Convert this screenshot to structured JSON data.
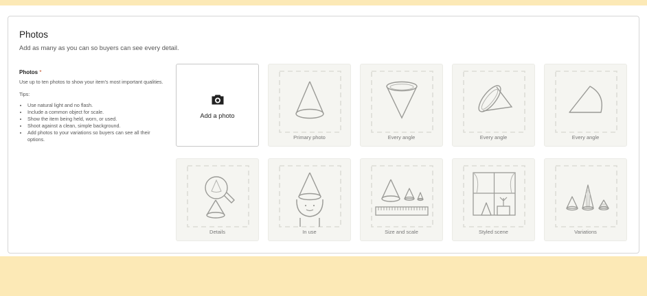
{
  "section": {
    "title": "Photos",
    "subtitle": "Add as many as you can so buyers can see every detail."
  },
  "sidebar": {
    "label": "Photos",
    "required_marker": "*",
    "description": "Use up to ten photos to show your item's most important qualities.",
    "tips_heading": "Tips:",
    "tips": [
      "Use natural light and no flash.",
      "Include a common object for scale.",
      "Show the item being held, worn, or used.",
      "Shoot against a clean, simple background.",
      "Add photos to your variations so buyers can see all their options."
    ]
  },
  "uploader": {
    "add_label": "Add a photo",
    "add_icon": "camera-icon"
  },
  "slots": [
    {
      "caption": "Primary photo",
      "icon": "cone-icon"
    },
    {
      "caption": "Every angle",
      "icon": "inverted-cone-icon"
    },
    {
      "caption": "Every angle",
      "icon": "tilted-cone-icon"
    },
    {
      "caption": "Every angle",
      "icon": "side-cone-icon"
    },
    {
      "caption": "Details",
      "icon": "magnifier-cone-icon"
    },
    {
      "caption": "In use",
      "icon": "cone-hat-person-icon"
    },
    {
      "caption": "Size and scale",
      "icon": "cones-ruler-icon"
    },
    {
      "caption": "Styled scene",
      "icon": "window-scene-icon"
    },
    {
      "caption": "Variations",
      "icon": "cone-variations-icon"
    }
  ],
  "colors": {
    "page_background": "#fce9b6",
    "tile_background": "#f5f5f1",
    "placeholder_stroke": "#dcdcd6",
    "illustration_stroke": "#9a9a96",
    "required_color": "#c4512a"
  }
}
